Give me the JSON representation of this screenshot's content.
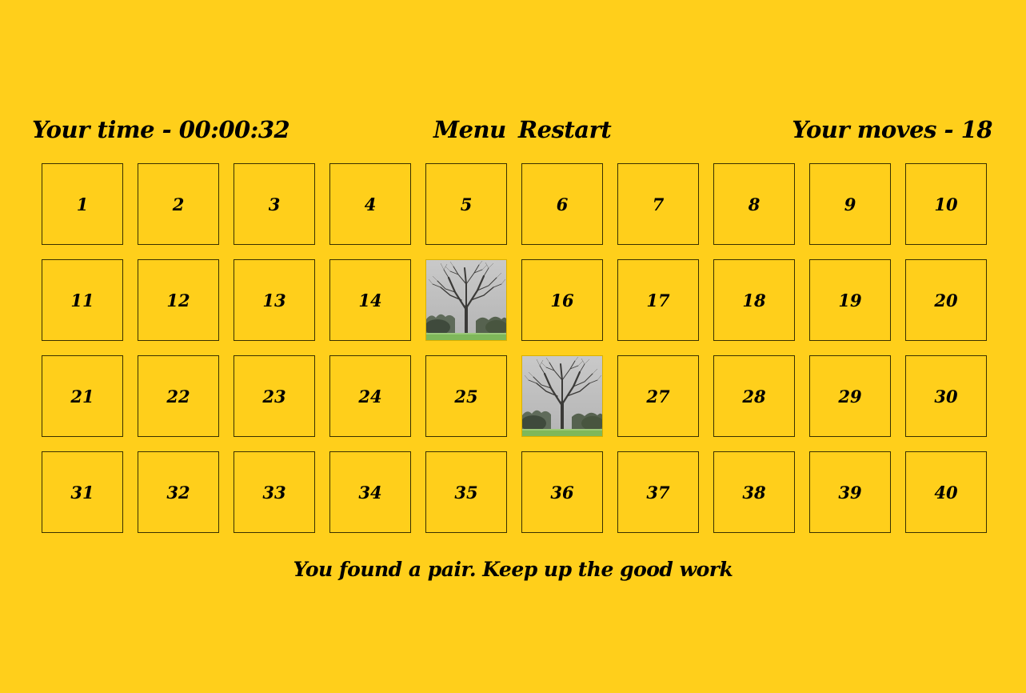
{
  "hud": {
    "time_label": "Your time - 00:00:32",
    "moves_label": "Your moves - 18",
    "menu_label": "Menu",
    "restart_label": "Restart"
  },
  "board": {
    "rows": 4,
    "columns": 10,
    "cards": [
      {
        "label": "1",
        "revealed": false
      },
      {
        "label": "2",
        "revealed": false
      },
      {
        "label": "3",
        "revealed": false
      },
      {
        "label": "4",
        "revealed": false
      },
      {
        "label": "5",
        "revealed": false
      },
      {
        "label": "6",
        "revealed": false
      },
      {
        "label": "7",
        "revealed": false
      },
      {
        "label": "8",
        "revealed": false
      },
      {
        "label": "9",
        "revealed": false
      },
      {
        "label": "10",
        "revealed": false
      },
      {
        "label": "11",
        "revealed": false
      },
      {
        "label": "12",
        "revealed": false
      },
      {
        "label": "13",
        "revealed": false
      },
      {
        "label": "14",
        "revealed": false
      },
      {
        "label": "",
        "revealed": true,
        "image": "bare-tree-photo"
      },
      {
        "label": "16",
        "revealed": false
      },
      {
        "label": "17",
        "revealed": false
      },
      {
        "label": "18",
        "revealed": false
      },
      {
        "label": "19",
        "revealed": false
      },
      {
        "label": "20",
        "revealed": false
      },
      {
        "label": "21",
        "revealed": false
      },
      {
        "label": "22",
        "revealed": false
      },
      {
        "label": "23",
        "revealed": false
      },
      {
        "label": "24",
        "revealed": false
      },
      {
        "label": "25",
        "revealed": false
      },
      {
        "label": "",
        "revealed": true,
        "image": "bare-tree-photo"
      },
      {
        "label": "27",
        "revealed": false
      },
      {
        "label": "28",
        "revealed": false
      },
      {
        "label": "29",
        "revealed": false
      },
      {
        "label": "30",
        "revealed": false
      },
      {
        "label": "31",
        "revealed": false
      },
      {
        "label": "32",
        "revealed": false
      },
      {
        "label": "33",
        "revealed": false
      },
      {
        "label": "34",
        "revealed": false
      },
      {
        "label": "35",
        "revealed": false
      },
      {
        "label": "36",
        "revealed": false
      },
      {
        "label": "37",
        "revealed": false
      },
      {
        "label": "38",
        "revealed": false
      },
      {
        "label": "39",
        "revealed": false
      },
      {
        "label": "40",
        "revealed": false
      }
    ]
  },
  "message": "You found a pair. Keep up the good work",
  "colors": {
    "background": "#ffcf1b",
    "text": "#000000",
    "card_border": "#3a3000"
  }
}
